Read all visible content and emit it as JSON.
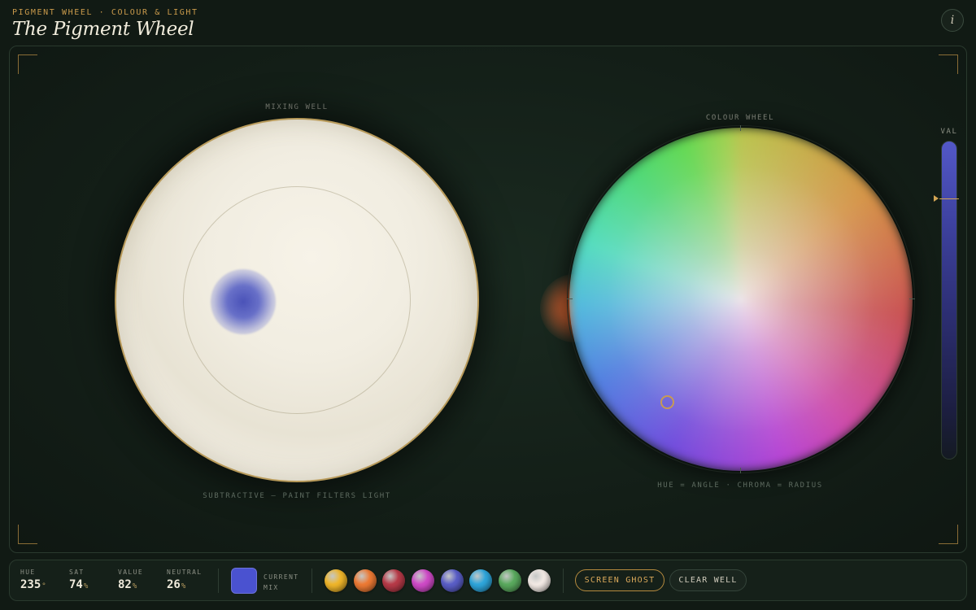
{
  "header": {
    "kicker": "PIGMENT WHEEL · COLOUR & LIGHT",
    "title": "The Pigment Wheel",
    "info_label": "i"
  },
  "mixing_well": {
    "label": "MIXING WELL",
    "caption": "SUBTRACTIVE — PAINT FILTERS LIGHT",
    "blob_color": "#4a52b8"
  },
  "colour_wheel": {
    "label": "COLOUR WHEEL",
    "caption": "HUE = ANGLE · CHROMA = RADIUS",
    "ghost_color": "#e0662e"
  },
  "value_slider": {
    "label": "VAL",
    "level": 0.82
  },
  "stats": [
    {
      "key": "HUE",
      "value": "235",
      "unit": "°"
    },
    {
      "key": "SAT",
      "value": "74",
      "unit": "%"
    },
    {
      "key": "VALUE",
      "value": "82",
      "unit": "%"
    },
    {
      "key": "NEUTRAL",
      "value": "26",
      "unit": "%"
    }
  ],
  "current_mix": {
    "label_line1": "CURRENT",
    "label_line2": "MIX",
    "color": "#4a52d0"
  },
  "pigments": [
    {
      "name": "yellow",
      "color": "#f0b62a"
    },
    {
      "name": "orange",
      "color": "#ee7a34"
    },
    {
      "name": "crimson",
      "color": "#b83a48"
    },
    {
      "name": "magenta",
      "color": "#d04ac8"
    },
    {
      "name": "ultramarine",
      "color": "#5a5ec8"
    },
    {
      "name": "cerulean",
      "color": "#2ea6dc"
    },
    {
      "name": "green",
      "color": "#5aaa5e"
    },
    {
      "name": "white",
      "color": "#f4ebe6"
    }
  ],
  "buttons": {
    "screen_ghost": "SCREEN GHOST",
    "clear_well": "CLEAR WELL"
  },
  "colors": {
    "accent": "#c99a4b",
    "background": "#111a14"
  }
}
